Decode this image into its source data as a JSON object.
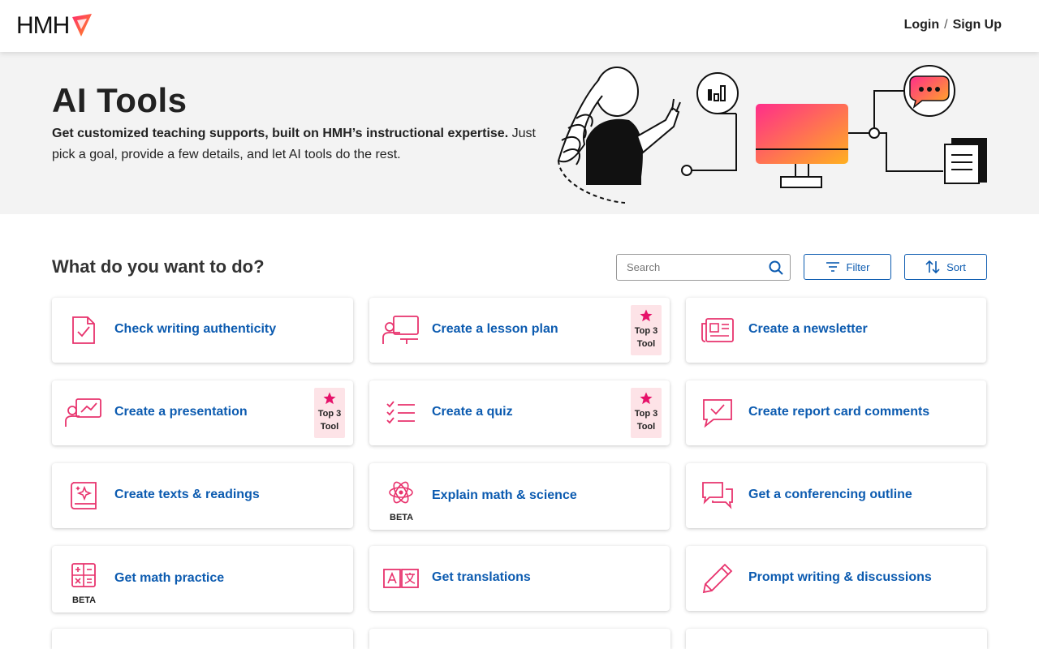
{
  "header": {
    "logo_text": "HMH",
    "login": "Login",
    "separator": "/",
    "signup": "Sign Up"
  },
  "hero": {
    "title": "AI Tools",
    "lead_bold": "Get customized teaching supports, built on HMH’s instructional expertise.",
    "lead_rest": " Just pick a goal, provide a few details, and let AI tools do the rest."
  },
  "section": {
    "title": "What do you want to do?"
  },
  "search": {
    "placeholder": "Search",
    "value": ""
  },
  "filter_label": "Filter",
  "sort_label": "Sort",
  "badge": {
    "line1": "Top 3",
    "line2": "Tool"
  },
  "beta_label": "BETA",
  "colors": {
    "accent": "#0c5bb0",
    "icon_pink": "#e8336d",
    "badge_bg": "#fde3e7",
    "star": "#e6126a"
  },
  "tools": [
    {
      "label": "Check writing authenticity",
      "icon": "document-check-icon",
      "top3": false,
      "beta": false
    },
    {
      "label": "Create a lesson plan",
      "icon": "teacher-board-icon",
      "top3": true,
      "beta": false
    },
    {
      "label": "Create a newsletter",
      "icon": "newspaper-icon",
      "top3": false,
      "beta": false
    },
    {
      "label": "Create a presentation",
      "icon": "presenter-icon",
      "top3": true,
      "beta": false
    },
    {
      "label": "Create a quiz",
      "icon": "checklist-icon",
      "top3": true,
      "beta": false
    },
    {
      "label": "Create report card comments",
      "icon": "comment-check-icon",
      "top3": false,
      "beta": false
    },
    {
      "label": "Create texts & readings",
      "icon": "book-sparkle-icon",
      "top3": false,
      "beta": false
    },
    {
      "label": "Explain math & science",
      "icon": "atom-icon",
      "top3": false,
      "beta": true
    },
    {
      "label": "Get a conferencing outline",
      "icon": "conversation-icon",
      "top3": false,
      "beta": false
    },
    {
      "label": "Get math practice",
      "icon": "calculator-icon",
      "top3": false,
      "beta": true
    },
    {
      "label": "Get translations",
      "icon": "translate-icon",
      "top3": false,
      "beta": false
    },
    {
      "label": "Prompt writing & discussions",
      "icon": "pencil-icon",
      "top3": false,
      "beta": false
    }
  ]
}
